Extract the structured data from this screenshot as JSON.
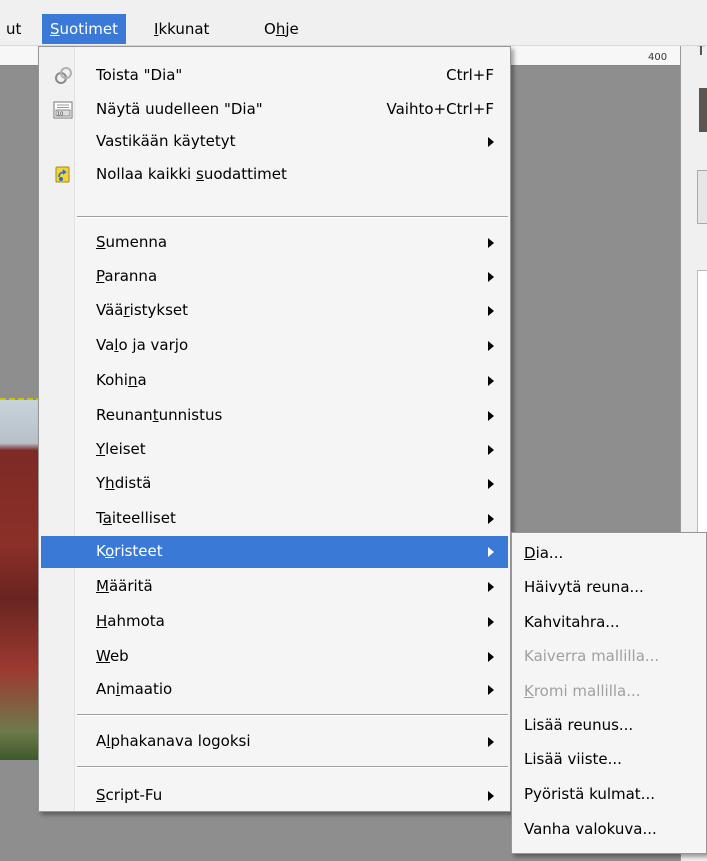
{
  "menubar": {
    "items": [
      {
        "label": "ut",
        "underline_index": -1
      },
      {
        "label": "Suotimet",
        "underline_index": 0
      },
      {
        "label": "Ikkunat",
        "underline_index": 0
      },
      {
        "label": "Ohje",
        "underline_index": 1
      }
    ]
  },
  "ruler": {
    "label": "400"
  },
  "dock": {
    "title": "T"
  },
  "menu": {
    "items": [
      {
        "label": "Toista \"Dia\"",
        "shortcut": "Ctrl+F",
        "icon": "repeat-filter-icon"
      },
      {
        "label": "Näytä uudelleen \"Dia\"",
        "shortcut": "Vaihto+Ctrl+F",
        "icon": "reshow-filter-icon"
      },
      {
        "label": "Vastikään käytetyt",
        "submenu": true
      },
      {
        "label": "Nollaa kaikki suodattimet",
        "icon": "reset-filters-icon",
        "ul": "s"
      },
      {
        "label": "Sumenna",
        "submenu": true,
        "ul": "S"
      },
      {
        "label": "Paranna",
        "submenu": true,
        "ul": "P"
      },
      {
        "label": "Vääristykset",
        "submenu": true,
        "ul": "r"
      },
      {
        "label": "Valo ja varjo",
        "submenu": true,
        "ul": "l"
      },
      {
        "label": "Kohina",
        "submenu": true,
        "ul": "n"
      },
      {
        "label": "Reunantunnistus",
        "submenu": true,
        "ul": "t"
      },
      {
        "label": "Yleiset",
        "submenu": true,
        "ul": "Y"
      },
      {
        "label": "Yhdistä",
        "submenu": true,
        "ul": "h"
      },
      {
        "label": "Taiteelliset",
        "submenu": true,
        "ul": "a"
      },
      {
        "label": "Koristeet",
        "submenu": true,
        "ul": "o",
        "highlighted": true
      },
      {
        "label": "Määritä",
        "submenu": true,
        "ul": "M"
      },
      {
        "label": "Hahmota",
        "submenu": true,
        "ul": "H"
      },
      {
        "label": "Web",
        "submenu": true,
        "ul": "W"
      },
      {
        "label": "Animaatio",
        "submenu": true,
        "ul": "i"
      },
      {
        "label": "Alphakanava logoksi",
        "submenu": true,
        "ul": "l"
      },
      {
        "label": "Script-Fu",
        "submenu": true,
        "ul": "S"
      }
    ]
  },
  "submenu": {
    "items": [
      {
        "label": "Dia...",
        "enabled": true,
        "ul": "D"
      },
      {
        "label": "Häivytä reuna...",
        "enabled": true
      },
      {
        "label": "Kahvitahra...",
        "enabled": true
      },
      {
        "label": "Kaiverra mallilla...",
        "enabled": false
      },
      {
        "label": "Kromi mallilla...",
        "enabled": false,
        "ul": "K"
      },
      {
        "label": "Lisää reunus...",
        "enabled": true
      },
      {
        "label": "Lisää viiste...",
        "enabled": true
      },
      {
        "label": "Pyöristä kulmat...",
        "enabled": true
      },
      {
        "label": "Vanha valokuva...",
        "enabled": true
      }
    ]
  },
  "colors": {
    "highlight": "#3a79d5",
    "menu_bg": "#f5f5f5",
    "disabled_text": "#a0a0a0"
  }
}
